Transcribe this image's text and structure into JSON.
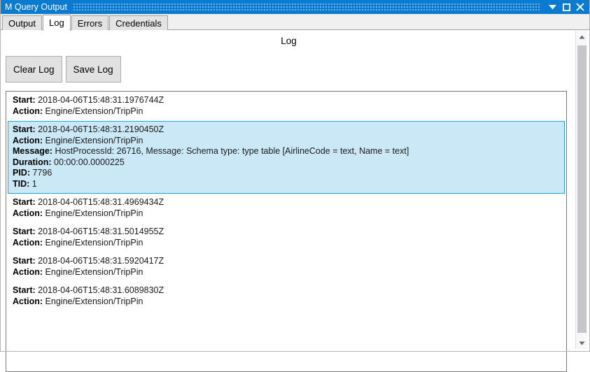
{
  "window": {
    "title": "M Query Output",
    "controls": [
      {
        "name": "minimize-button",
        "glyph": "chevron-down-icon"
      },
      {
        "name": "maximize-button",
        "glyph": "square-icon"
      },
      {
        "name": "close-button",
        "glyph": "close-icon"
      }
    ]
  },
  "tabs": [
    {
      "label": "Output",
      "selected": false
    },
    {
      "label": "Log",
      "selected": true
    },
    {
      "label": "Errors",
      "selected": false
    },
    {
      "label": "Credentials",
      "selected": false
    }
  ],
  "page": {
    "heading": "Log",
    "buttons": [
      {
        "label": "Clear Log",
        "name": "clear-log-button"
      },
      {
        "label": "Save Log",
        "name": "save-log-button"
      }
    ]
  },
  "log_entries": [
    {
      "selected": false,
      "fields": [
        {
          "key": "Start:",
          "value": "2018-04-06T15:48:31.1976744Z"
        },
        {
          "key": "Action:",
          "value": "Engine/Extension/TripPin"
        }
      ]
    },
    {
      "selected": true,
      "fields": [
        {
          "key": "Start:",
          "value": "2018-04-06T15:48:31.2190450Z"
        },
        {
          "key": "Action:",
          "value": "Engine/Extension/TripPin"
        },
        {
          "key": "Message:",
          "value": "HostProcessId: 26716, Message: Schema type: type table [AirlineCode = text, Name = text]"
        },
        {
          "key": "Duration:",
          "value": "00:00:00.0000225"
        },
        {
          "key": "PID:",
          "value": "7796"
        },
        {
          "key": "TID:",
          "value": "1"
        }
      ]
    },
    {
      "selected": false,
      "fields": [
        {
          "key": "Start:",
          "value": "2018-04-06T15:48:31.4969434Z"
        },
        {
          "key": "Action:",
          "value": "Engine/Extension/TripPin"
        }
      ]
    },
    {
      "selected": false,
      "fields": [
        {
          "key": "Start:",
          "value": "2018-04-06T15:48:31.5014955Z"
        },
        {
          "key": "Action:",
          "value": "Engine/Extension/TripPin"
        }
      ]
    },
    {
      "selected": false,
      "fields": [
        {
          "key": "Start:",
          "value": "2018-04-06T15:48:31.5920417Z"
        },
        {
          "key": "Action:",
          "value": "Engine/Extension/TripPin"
        }
      ]
    },
    {
      "selected": false,
      "fields": [
        {
          "key": "Start:",
          "value": "2018-04-06T15:48:31.6089830Z"
        },
        {
          "key": "Action:",
          "value": "Engine/Extension/TripPin"
        }
      ]
    }
  ],
  "scrollbar": {
    "up_arrow": "triangle-up-icon",
    "down_arrow": "triangle-down-icon"
  },
  "colors": {
    "titlebar": "#0b7ad1",
    "selection_fill": "#cbe8f6",
    "selection_border": "#26a0da"
  }
}
